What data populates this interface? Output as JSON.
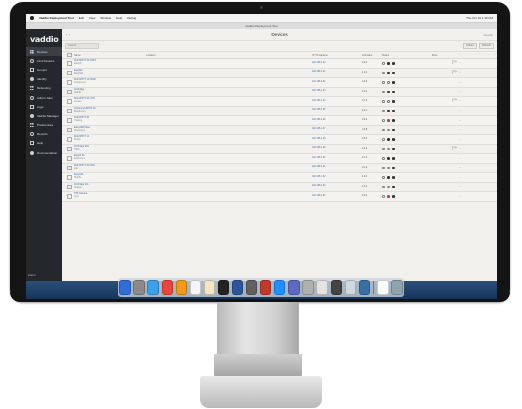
{
  "menubar": {
    "app": "Vaddio Deployment Tool",
    "items": [
      "Edit",
      "View",
      "Window",
      "Help",
      "Debug"
    ],
    "status": "Thu Oct 10  1:39 PM"
  },
  "window": {
    "title": "Vaddio Deployment Tool"
  },
  "sidebar": {
    "logo": "vaddio",
    "items": [
      {
        "label": "Devices",
        "icon": "grid-icon",
        "active": true
      },
      {
        "label": "Find Devices",
        "icon": "search-icon"
      },
      {
        "label": "Groups",
        "icon": "folder-icon"
      },
      {
        "label": "Identify",
        "icon": "lightbulb-icon"
      },
      {
        "label": "Rebooting",
        "icon": "refresh-icon"
      },
      {
        "label": "Admin Jobs",
        "icon": "briefcase-icon"
      },
      {
        "label": "Logs",
        "icon": "list-icon"
      },
      {
        "label": "Vaddio Manager",
        "icon": "monitor-icon"
      },
      {
        "label": "Preferences",
        "icon": "sliders-icon"
      },
      {
        "label": "Reports",
        "icon": "chart-icon"
      },
      {
        "label": "Help",
        "icon": "question-icon"
      },
      {
        "label": "Documentation",
        "icon": "book-icon"
      }
    ],
    "footer": "Zoom"
  },
  "main": {
    "title": "Devices",
    "header_right": "Search",
    "search_placeholder": "Search",
    "toolbar_buttons": [
      "Actions",
      "Refresh"
    ],
    "columns": [
      "Name",
      "Location",
      "IP / Hostname",
      "Firmware",
      "Status",
      "More"
    ],
    "rows": [
      {
        "name": "RoboSHOT 30 HDBT",
        "model": "EasyIP",
        "ip": "192.168.1.20",
        "fw": "2.0.3",
        "status": "on",
        "page": "Page 4"
      },
      {
        "name": "EasyMix",
        "model": "EasyTalk",
        "ip": "192.168.1.21",
        "fw": "1.2.0",
        "status": "on",
        "page": "Page 4"
      },
      {
        "name": "RoboSHOT 12 HDMI",
        "model": "Conference",
        "ip": "192.168.1.22",
        "fw": "2.0.3",
        "status": "off",
        "page": ""
      },
      {
        "name": "AV Bridge",
        "model": "Huddle",
        "ip": "192.168.1.23",
        "fw": "1.4.2",
        "status": "on",
        "page": ""
      },
      {
        "name": "RoboSHOT 40 UHD",
        "model": "Lecture",
        "ip": "192.168.1.24",
        "fw": "3.1.0",
        "status": "off",
        "page": "Page 3"
      },
      {
        "name": "ConferenceSHOT AV",
        "model": "Boardroom",
        "ip": "192.168.1.25",
        "fw": "2.2.1",
        "status": "on",
        "page": ""
      },
      {
        "name": "RoboSHOT 30",
        "model": "Training",
        "ip": "192.168.1.26",
        "fw": "2.0.3",
        "status": "red",
        "page": ""
      },
      {
        "name": "EasyUSB Mixer",
        "model": "Classroom",
        "ip": "192.168.1.27",
        "fw": "1.0.8",
        "status": "off",
        "page": ""
      },
      {
        "name": "RoboSHOT 12",
        "model": "Studio",
        "ip": "192.168.1.28",
        "fw": "2.0.3",
        "status": "on",
        "page": ""
      },
      {
        "name": "AV Bridge Mini",
        "model": "Office",
        "ip": "192.168.1.29",
        "fw": "1.4.2",
        "status": "off",
        "page": "Page 4"
      },
      {
        "name": "EasyIP 30",
        "model": "Auditorium",
        "ip": "192.168.1.30",
        "fw": "2.1.0",
        "status": "on",
        "page": ""
      },
      {
        "name": "RoboSHOT 20 UHD",
        "model": "Lab",
        "ip": "192.168.1.31",
        "fw": "3.1.0",
        "status": "off",
        "page": ""
      },
      {
        "name": "EasyTalk",
        "model": "Huddle",
        "ip": "192.168.1.32",
        "fw": "1.2.0",
        "status": "on",
        "page": ""
      },
      {
        "name": "AV Bridge 2x1",
        "model": "Chapel",
        "ip": "192.168.1.33",
        "fw": "1.4.2",
        "status": "off",
        "page": ""
      },
      {
        "name": "PTZ Camera",
        "model": "Gym",
        "ip": "192.168.1.34",
        "fw": "2.0.3",
        "status": "red",
        "page": ""
      }
    ]
  },
  "colors": {
    "sidebar": "#24272c",
    "link": "#3c6fb0",
    "alert": "#dd3333"
  }
}
